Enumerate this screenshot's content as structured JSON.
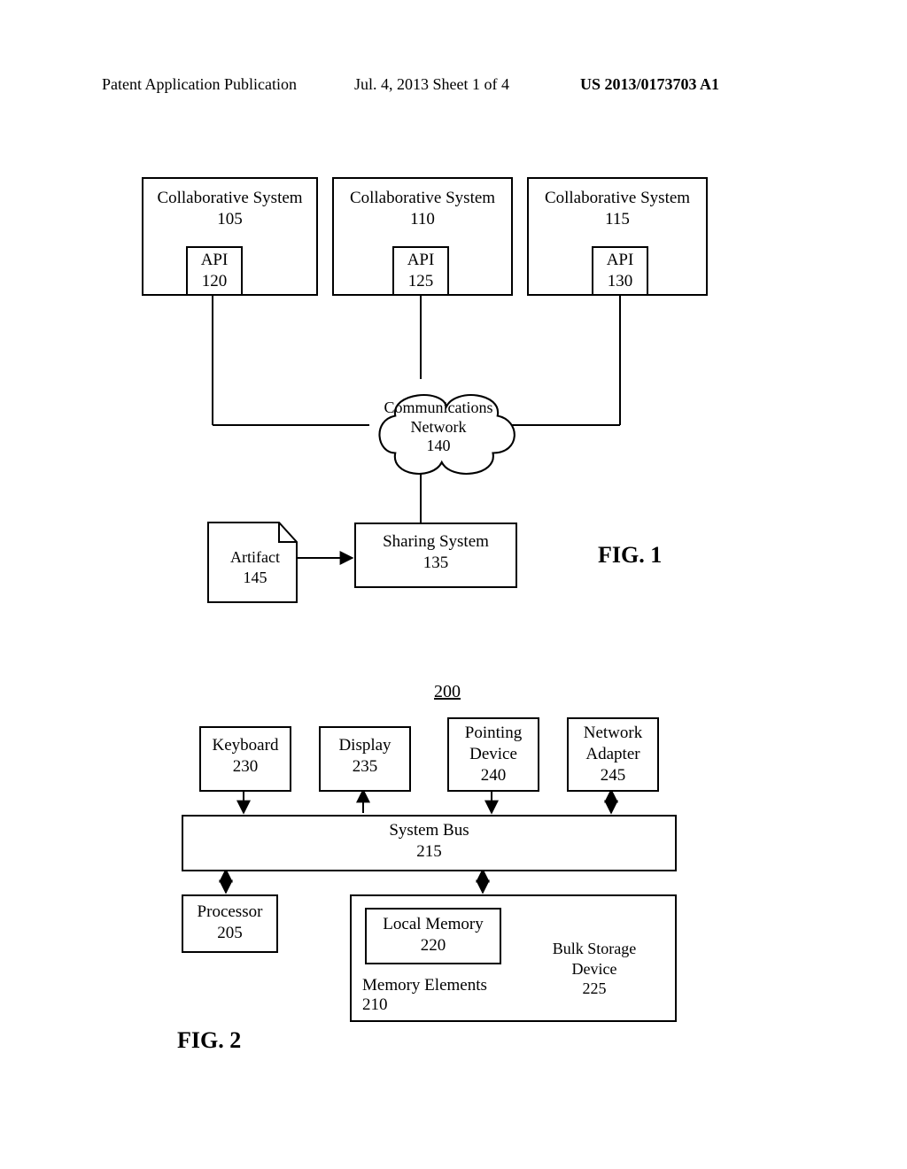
{
  "header": {
    "left": "Patent Application Publication",
    "center": "Jul. 4, 2013   Sheet 1 of 4",
    "right": "US 2013/0173703 A1"
  },
  "fig1": {
    "label": "FIG. 1",
    "cs1": {
      "title": "Collaborative System",
      "num": "105"
    },
    "cs2": {
      "title": "Collaborative System",
      "num": "110"
    },
    "cs3": {
      "title": "Collaborative System",
      "num": "115"
    },
    "api1": {
      "title": "API",
      "num": "120"
    },
    "api2": {
      "title": "API",
      "num": "125"
    },
    "api3": {
      "title": "API",
      "num": "130"
    },
    "network": {
      "title": "Communications",
      "sub": "Network",
      "num": "140"
    },
    "sharing": {
      "title": "Sharing System",
      "num": "135"
    },
    "artifact": {
      "title": "Artifact",
      "num": "145"
    }
  },
  "fig2": {
    "label": "FIG. 2",
    "ref": "200",
    "keyboard": {
      "title": "Keyboard",
      "num": "230"
    },
    "display": {
      "title": "Display",
      "num": "235"
    },
    "pointing": {
      "title": "Pointing",
      "sub": "Device",
      "num": "240"
    },
    "netadapter": {
      "title": "Network",
      "sub": "Adapter",
      "num": "245"
    },
    "bus": {
      "title": "System Bus",
      "num": "215"
    },
    "processor": {
      "title": "Processor",
      "num": "205"
    },
    "localmem": {
      "title": "Local Memory",
      "num": "220"
    },
    "memelem": {
      "title": "Memory Elements",
      "num": "210"
    },
    "bulk": {
      "title": "Bulk Storage",
      "sub": "Device",
      "num": "225"
    }
  }
}
